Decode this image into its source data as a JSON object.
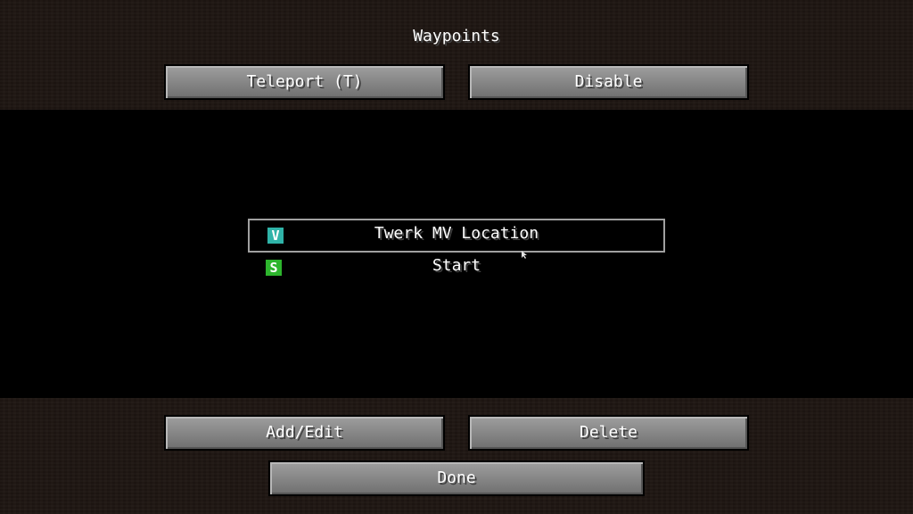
{
  "screen": {
    "title": "Waypoints"
  },
  "top_buttons": {
    "teleport_label": "Teleport (T)",
    "disable_label": "Disable"
  },
  "waypoints": [
    {
      "badge": "V",
      "badge_color": "#2fb3a8",
      "name": "Twerk MV Location",
      "selected": true
    },
    {
      "badge": "S",
      "badge_color": "#2db52d",
      "name": "Start",
      "selected": false
    }
  ],
  "bottom_buttons": {
    "add_edit_label": "Add/Edit",
    "delete_label": "Delete",
    "done_label": "Done"
  }
}
